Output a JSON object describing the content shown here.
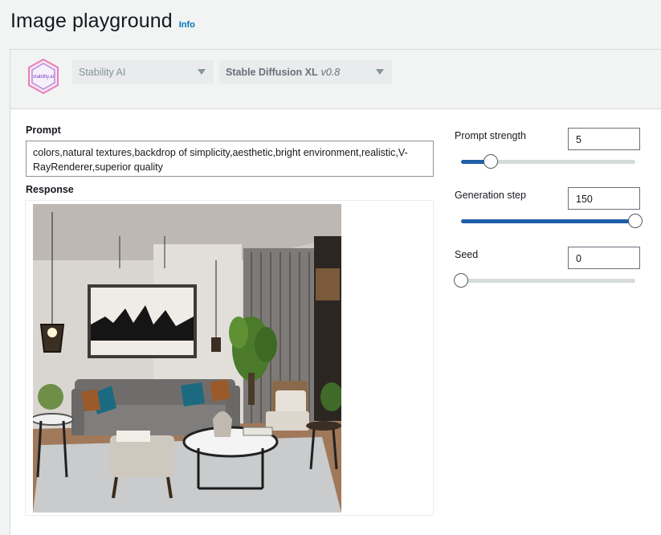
{
  "header": {
    "title": "Image playground",
    "info_label": "Info"
  },
  "model_bar": {
    "logo_text": "stability.ai",
    "provider": "Stability AI",
    "model_name": "Stable Diffusion XL",
    "model_version": "v0.8"
  },
  "prompt": {
    "label": "Prompt",
    "value": "colors,natural textures,backdrop of simplicity,aesthetic,bright environment,realistic,V-RayRenderer,superior  quality"
  },
  "response": {
    "label": "Response"
  },
  "params": {
    "prompt_strength": {
      "label": "Prompt strength",
      "value": "5",
      "fraction": 0.17
    },
    "generation_step": {
      "label": "Generation step",
      "value": "150",
      "fraction": 1.0
    },
    "seed": {
      "label": "Seed",
      "value": "0",
      "fraction": 0.0
    }
  },
  "colors": {
    "accent": "#1f5ea8",
    "info_link": "#0073bb",
    "track": "#d5dbdb"
  }
}
